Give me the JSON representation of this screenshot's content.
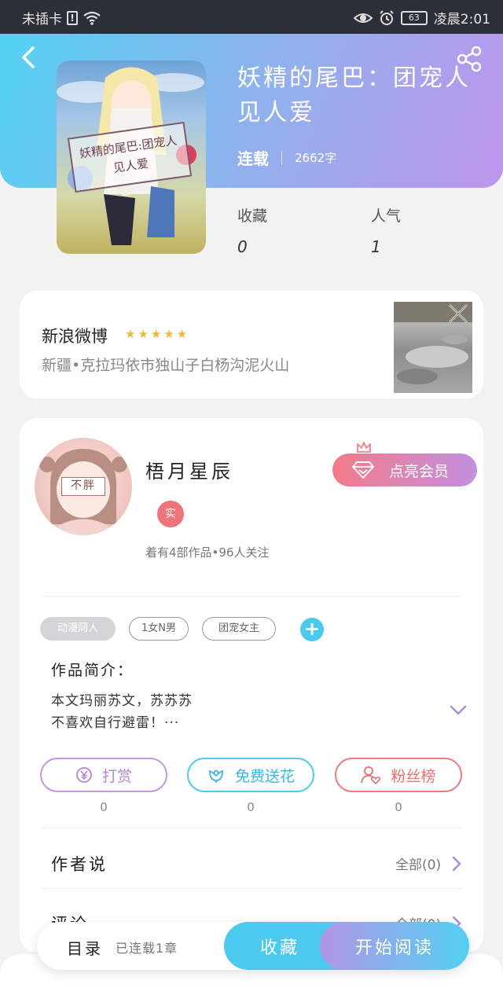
{
  "status_bar": {
    "carrier": "未插卡",
    "time": "凌晨2:01",
    "battery": "63",
    "sim_symbol": "!"
  },
  "book": {
    "title": "妖精的尾巴：团宠人见人爱",
    "cover_text": "妖精的尾巴:团宠人见人爱",
    "status": "连载",
    "word_count": "2662字",
    "stats": [
      {
        "label": "收藏",
        "value": "0"
      },
      {
        "label": "人气",
        "value": "1"
      }
    ]
  },
  "ad": {
    "title": "新浪微博",
    "stars": "★★★★★",
    "rating": 5,
    "description": "新疆•克拉玛依市独山子白杨沟泥火山"
  },
  "author": {
    "name": "梧月星辰",
    "avatar_text": "不胖",
    "badge": "实",
    "stats": "着有4部作品•96人关注",
    "vip_button": "点亮会员"
  },
  "tags": [
    "动漫同人",
    "1女N男",
    "团宠女主"
  ],
  "tag_add": "+",
  "intro": {
    "label": "作品简介：",
    "text": "本文玛丽苏文，苏苏苏\n不喜欢自行避雷！···"
  },
  "actions": [
    {
      "label": "打赏",
      "count": "0",
      "icon": "yen-icon"
    },
    {
      "label": "免费送花",
      "count": "0",
      "icon": "flower-icon"
    },
    {
      "label": "粉丝榜",
      "count": "0",
      "icon": "fans-icon"
    }
  ],
  "sections": [
    {
      "label": "作者说",
      "link": "全部(0)"
    },
    {
      "label": "评论",
      "link": "全部(0)"
    }
  ],
  "bottom_bar": {
    "toc_label": "目录",
    "toc_info": "已连载1章",
    "favorite_button": "收藏",
    "read_button": "开始阅读"
  },
  "colors": {
    "header_start": "#52d3f2",
    "header_end": "#bd95ec",
    "accent_blue": "#4cc9ef",
    "accent_purple": "#b295e6",
    "accent_pink": "#f0787c",
    "star": "#f4b53a"
  }
}
